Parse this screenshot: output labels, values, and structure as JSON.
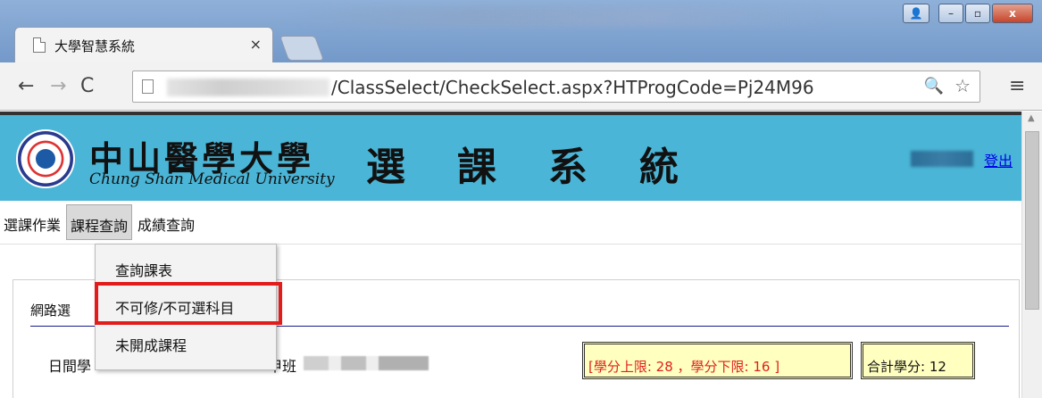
{
  "browser": {
    "tab_title": "大學智慧系統",
    "tab_close": "×",
    "url_path": "/ClassSelect/CheckSelect.aspx?HTProgCode=Pj24M96",
    "nav": {
      "back": "←",
      "forward": "→",
      "reload": "C"
    },
    "icons": {
      "zoom": "🔍",
      "star": "☆",
      "menu": "≡"
    },
    "window_controls": {
      "minimize": "–",
      "maximize": "▫",
      "close": "x"
    }
  },
  "header": {
    "university_zh": "中山醫學大學",
    "university_en": "Chung Shan Medical University",
    "system_title": "選課系統",
    "logout": "登出"
  },
  "menu": {
    "items": [
      {
        "label": "選課作業"
      },
      {
        "label": "課程查詢"
      },
      {
        "label": "成績查詢"
      }
    ]
  },
  "dropdown": {
    "items": [
      {
        "label": "查詢課表"
      },
      {
        "label": "不可修/不可選科目"
      },
      {
        "label": "未開成課程"
      }
    ]
  },
  "content": {
    "section_label": "網路選",
    "dept_label": "日間學",
    "class_label": "甲班",
    "credit_limit": "[學分上限: 28 ，學分下限: 16 ]",
    "credit_total": "合計學分: 12"
  },
  "colors": {
    "banner": "#4ab5d6",
    "highlight": "#e21b1b",
    "credit_bg": "#ffffc0",
    "credit_limit_text": "#e02020",
    "link": "#0000ee"
  }
}
